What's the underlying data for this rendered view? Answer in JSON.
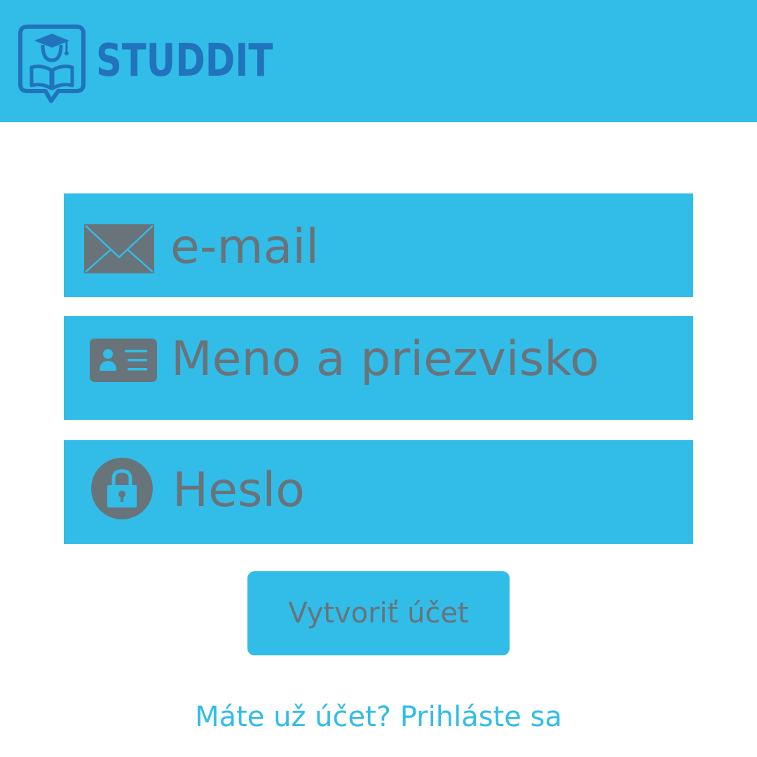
{
  "header": {
    "brand": "STUDDIT",
    "logo_icon": "graduate-reading-book-icon",
    "background_color": "#32bde9",
    "brand_color": "#2173bb"
  },
  "form": {
    "email": {
      "placeholder": "e-mail",
      "icon": "envelope-icon"
    },
    "full_name": {
      "placeholder": "Meno a priezvisko",
      "icon": "id-card-icon"
    },
    "password": {
      "placeholder": "Heslo",
      "icon": "padlock-icon"
    },
    "submit_label": "Vytvoriť účet"
  },
  "footer": {
    "login_prompt": "Máte už účet? Prihláste sa"
  },
  "colors": {
    "accent": "#32bde9",
    "field_text": "#697379",
    "icon": "#687479"
  }
}
